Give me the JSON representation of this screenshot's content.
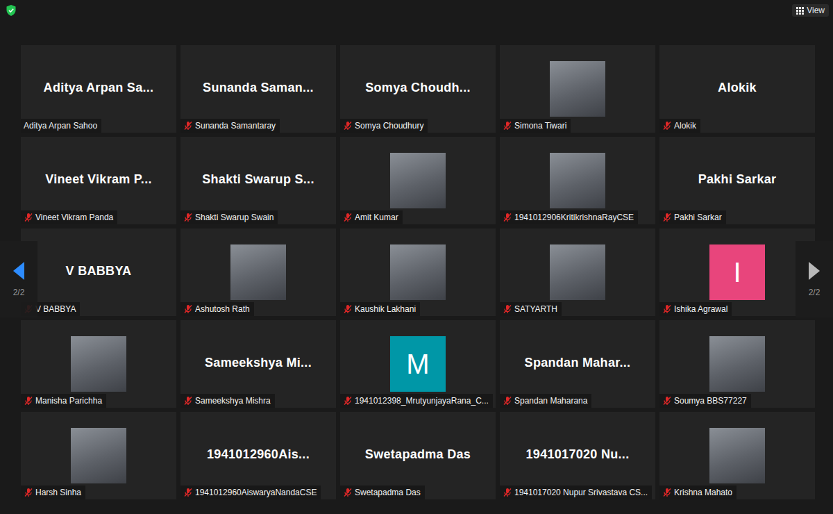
{
  "window": {
    "title_bar": {
      "view_button": {
        "label": "View"
      }
    }
  },
  "participants": [
    {
      "display": "Aditya Arpan Sa...",
      "label": "Aditya Arpan Sahoo",
      "muted": false,
      "kind": "name"
    },
    {
      "display": "Sunanda Saman...",
      "label": "Sunanda Samantaray",
      "muted": true,
      "kind": "name"
    },
    {
      "display": "Somya Choudh...",
      "label": "Somya Choudhury",
      "muted": true,
      "kind": "name"
    },
    {
      "label": "Simona Tiwari",
      "muted": true,
      "kind": "photo"
    },
    {
      "display": "Alokik",
      "label": "Alokik",
      "muted": true,
      "kind": "name"
    },
    {
      "display": "Vineet Vikram P...",
      "label": "Vineet Vikram Panda",
      "muted": true,
      "kind": "name"
    },
    {
      "display": "Shakti Swarup S...",
      "label": "Shakti Swarup Swain",
      "muted": true,
      "kind": "name"
    },
    {
      "label": "Amit Kumar",
      "muted": true,
      "kind": "photo"
    },
    {
      "label": "1941012906KritikrishnaRayCSE",
      "muted": true,
      "kind": "photo"
    },
    {
      "display": "Pakhi Sarkar",
      "label": "Pakhi Sarkar",
      "muted": true,
      "kind": "name"
    },
    {
      "display": "V BABBYA",
      "label": "V BABBYA",
      "muted": true,
      "kind": "name"
    },
    {
      "label": "Ashutosh Rath",
      "muted": true,
      "kind": "photo"
    },
    {
      "label": "Kaushik Lakhani",
      "muted": true,
      "kind": "photo"
    },
    {
      "label": "SATYARTH",
      "muted": true,
      "kind": "photo"
    },
    {
      "letter": "I",
      "label": "Ishika Agrawal",
      "muted": true,
      "kind": "letter",
      "color": "#e8457c"
    },
    {
      "label": "Manisha Parichha",
      "muted": true,
      "kind": "photo"
    },
    {
      "display": "Sameekshya Mi...",
      "label": "Sameekshya Mishra",
      "muted": true,
      "kind": "name"
    },
    {
      "letter": "M",
      "label": "1941012398_MrutyunjayaRana_C...",
      "muted": true,
      "kind": "letter",
      "color": "#0097a7"
    },
    {
      "display": "Spandan Mahar...",
      "label": "Spandan Maharana",
      "muted": true,
      "kind": "name"
    },
    {
      "label": "Soumya BBS77227",
      "muted": true,
      "kind": "photo"
    },
    {
      "label": "Harsh Sinha",
      "muted": true,
      "kind": "photo"
    },
    {
      "display": "1941012960Ais...",
      "label": "1941012960AiswaryaNandaCSE",
      "muted": true,
      "kind": "name"
    },
    {
      "display": "Swetapadma Das",
      "label": "Swetapadma Das",
      "muted": true,
      "kind": "name"
    },
    {
      "display": "1941017020 Nu...",
      "label": "1941017020 Nupur Srivastava CS...",
      "muted": true,
      "kind": "name"
    },
    {
      "label": "Krishna Mahato",
      "muted": true,
      "kind": "photo"
    }
  ],
  "pager": {
    "previous": {
      "label": "2/2",
      "enabled": true
    },
    "next": {
      "label": "2/2",
      "enabled": false
    }
  }
}
